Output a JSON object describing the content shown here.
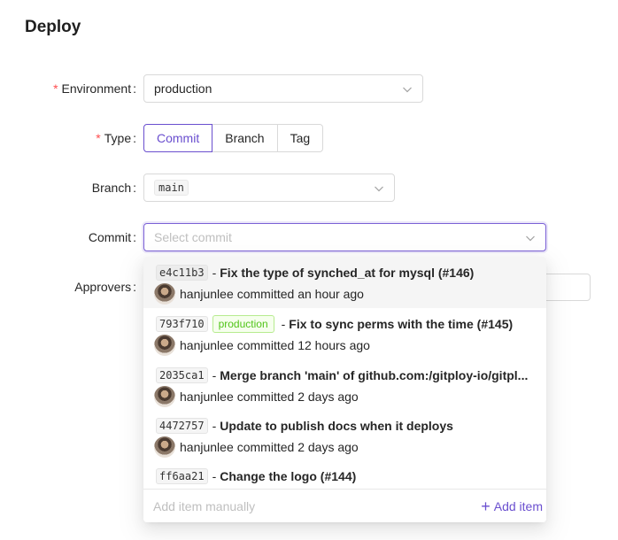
{
  "page": {
    "title": "Deploy"
  },
  "form": {
    "environment": {
      "label": "Environment",
      "value": "production",
      "required": true
    },
    "type": {
      "label": "Type",
      "required": true,
      "options": [
        "Commit",
        "Branch",
        "Tag"
      ],
      "selected": "Commit"
    },
    "branch": {
      "label": "Branch",
      "value": "main"
    },
    "commit": {
      "label": "Commit",
      "placeholder": "Select commit"
    },
    "approvers": {
      "label": "Approvers"
    }
  },
  "colon": ":",
  "required_mark": "*",
  "dropdown": {
    "options": [
      {
        "sha": "e4c11b3",
        "message": "Fix the type of synched_at for mysql (#146)",
        "author": "hanjunlee",
        "committed": "committed an hour ago",
        "tag": ""
      },
      {
        "sha": "793f710",
        "message": "Fix to sync perms with the time (#145)",
        "author": "hanjunlee",
        "committed": "committed 12 hours ago",
        "tag": "production"
      },
      {
        "sha": "2035ca1",
        "message": "Merge branch 'main' of github.com:/gitploy-io/gitpl...",
        "author": "hanjunlee",
        "committed": "committed 2 days ago",
        "tag": ""
      },
      {
        "sha": "4472757",
        "message": "Update to publish docs when it deploys",
        "author": "hanjunlee",
        "committed": "committed 2 days ago",
        "tag": ""
      },
      {
        "sha": "ff6aa21",
        "message": "Change the logo (#144)",
        "author": "",
        "committed": "",
        "tag": ""
      }
    ],
    "dash": "-",
    "footer": {
      "manual_placeholder": "Add item manually",
      "add_label": "Add item",
      "add_icon": "plus-icon"
    }
  },
  "colors": {
    "accent": "#6a4fcf",
    "required": "#ff4d4f",
    "env_tag": "#52c41a"
  }
}
